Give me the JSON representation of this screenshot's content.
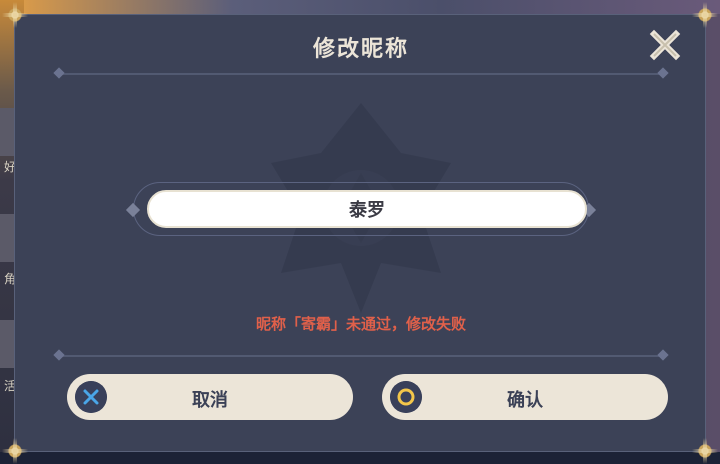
{
  "dialog": {
    "title": "修改昵称",
    "close_icon": "close-icon",
    "nickname_value": "泰罗",
    "error_message": "昵称「寄霸」未通过，修改失败",
    "cancel_label": "取消",
    "cancel_icon": "cross-button-icon",
    "confirm_label": "确认",
    "confirm_icon": "circle-button-icon"
  },
  "background": {
    "side_labels": [
      "好",
      "角",
      "活"
    ]
  },
  "colors": {
    "panel": "#3c4257",
    "title_text": "#ece5d8",
    "error_text": "#e0604a",
    "button_bg": "#ece5d8",
    "cross_icon": "#4aa6e8",
    "circle_icon": "#f3c64a"
  }
}
